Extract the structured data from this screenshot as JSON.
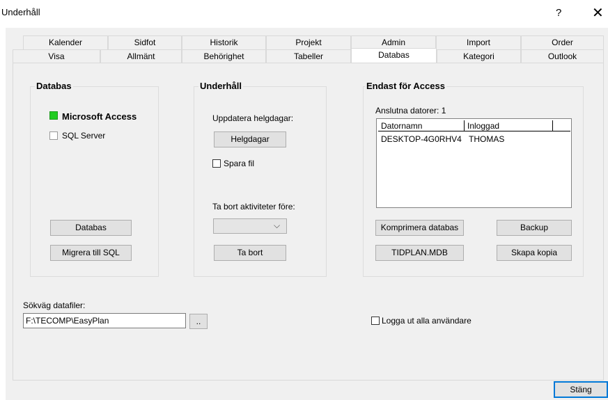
{
  "window": {
    "title": "Underhåll",
    "help": "?",
    "close": "✕"
  },
  "tabs_row1": [
    "Kalender",
    "Sidfot",
    "Historik",
    "Projekt",
    "Admin",
    "Import",
    "Order"
  ],
  "tabs_row2": [
    "Visa",
    "Allmänt",
    "Behörighet",
    "Tabeller",
    "Databas",
    "Kategori",
    "Outlook"
  ],
  "active_tab": "Databas",
  "databas": {
    "title": "Databas",
    "microsoft_access": "Microsoft Access",
    "sql_server": "SQL Server",
    "databas_button": "Databas",
    "migrate_button": "Migrera till SQL",
    "access_color": "#22cc22"
  },
  "underhall": {
    "title": "Underhåll",
    "update_holidays_label": "Uppdatera helgdagar:",
    "holidays_button": "Helgdagar",
    "save_file": "Spara fil",
    "remove_label": "Ta bort aktiviteter före:",
    "remove_button": "Ta bort"
  },
  "access": {
    "title": "Endast för Access",
    "connected": "Anslutna datorer: 1",
    "columns": [
      "Datornamn",
      "Inloggad"
    ],
    "rows": [
      [
        "DESKTOP-4G0RHV4",
        "THOMAS"
      ]
    ],
    "compact_button": "Komprimera databas",
    "backup_button": "Backup",
    "tidplan_button": "TIDPLAN.MDB",
    "copy_button": "Skapa kopia"
  },
  "path": {
    "label": "Sökväg datafiler:",
    "value": "F:\\TECOMP\\EasyPlan",
    "browse": ".."
  },
  "logout_all": "Logga ut alla användare",
  "close_button": "Stäng"
}
